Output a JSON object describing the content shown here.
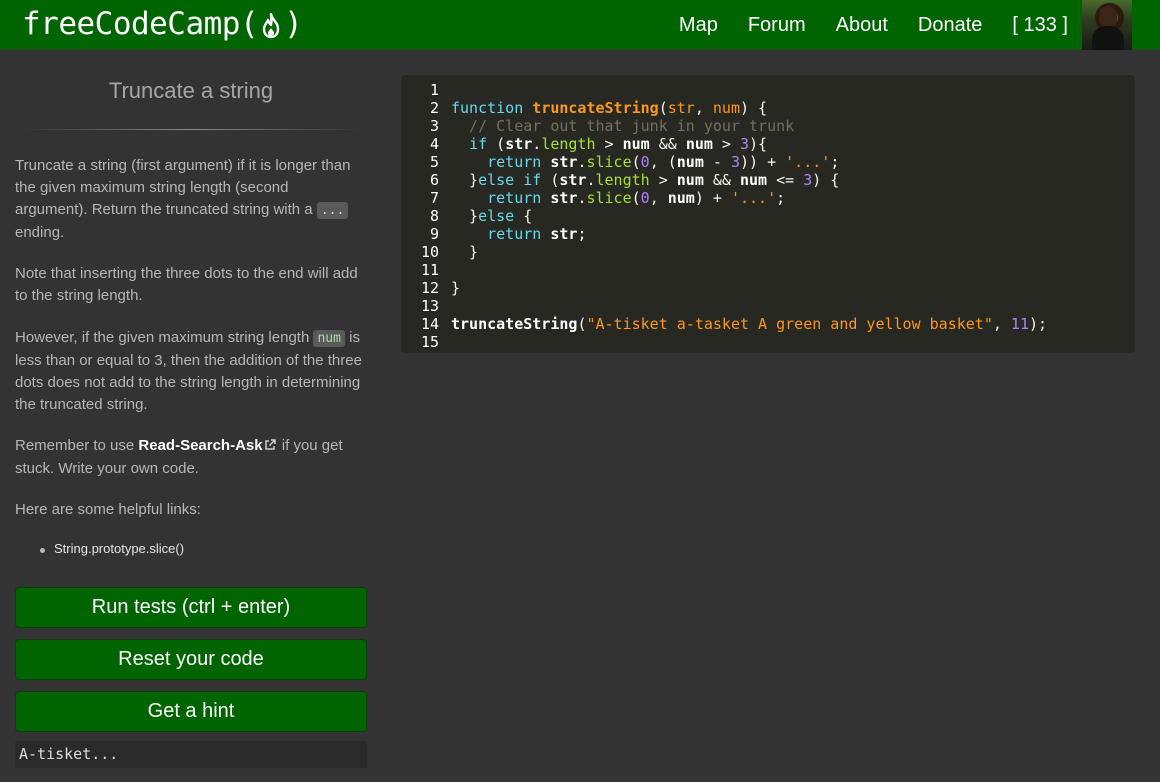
{
  "navbar": {
    "brand_text": "freeCodeCamp",
    "brand_open": "(",
    "brand_close": ")",
    "links": [
      "Map",
      "Forum",
      "About",
      "Donate"
    ],
    "points": "[ 133 ]",
    "accent_color": "#006400"
  },
  "challenge": {
    "title": "Truncate a string",
    "para1_text": "Truncate a string (first argument) if it is longer than the given maximum string length (second argument). Return the truncated string with a",
    "para1_code": "...",
    "para1_tail": "ending.",
    "para2": "Note that inserting the three dots to the end will add to the string length.",
    "para3_a": "However, if the given maximum string length",
    "para3_code": "num",
    "para3_b": "is less than or equal to 3, then the addition of the three dots does not add to the string length in determining the truncated string.",
    "para4_a": "Remember to use",
    "para4_link": "Read-Search-Ask",
    "para4_b": "if you get stuck. Write your own code.",
    "links_heading": "Here are some helpful links:",
    "helpful_links": [
      "String.prototype.slice()"
    ]
  },
  "buttons": {
    "run": "Run tests (ctrl + enter)",
    "reset": "Reset your code",
    "hint": "Get a hint"
  },
  "output": "A-tisket...",
  "editor": {
    "line_numbers": [
      "1",
      "2",
      "3",
      "4",
      "5",
      "6",
      "7",
      "8",
      "9",
      "10",
      "11",
      "12",
      "13",
      "14",
      "15"
    ],
    "code": [
      "",
      "function truncateString(str, num) {",
      "  // Clear out that junk in your trunk",
      "  if (str.length > num && num > 3){",
      "    return str.slice(0, (num - 3)) + '...';",
      "  }else if (str.length > num && num <= 3) {",
      "    return str.slice(0, num) + '...';",
      "  }else {",
      "    return str;",
      "  }",
      "",
      "}",
      "",
      "truncateString(\"A-tisket a-tasket A green and yellow basket\", 11);",
      ""
    ]
  }
}
